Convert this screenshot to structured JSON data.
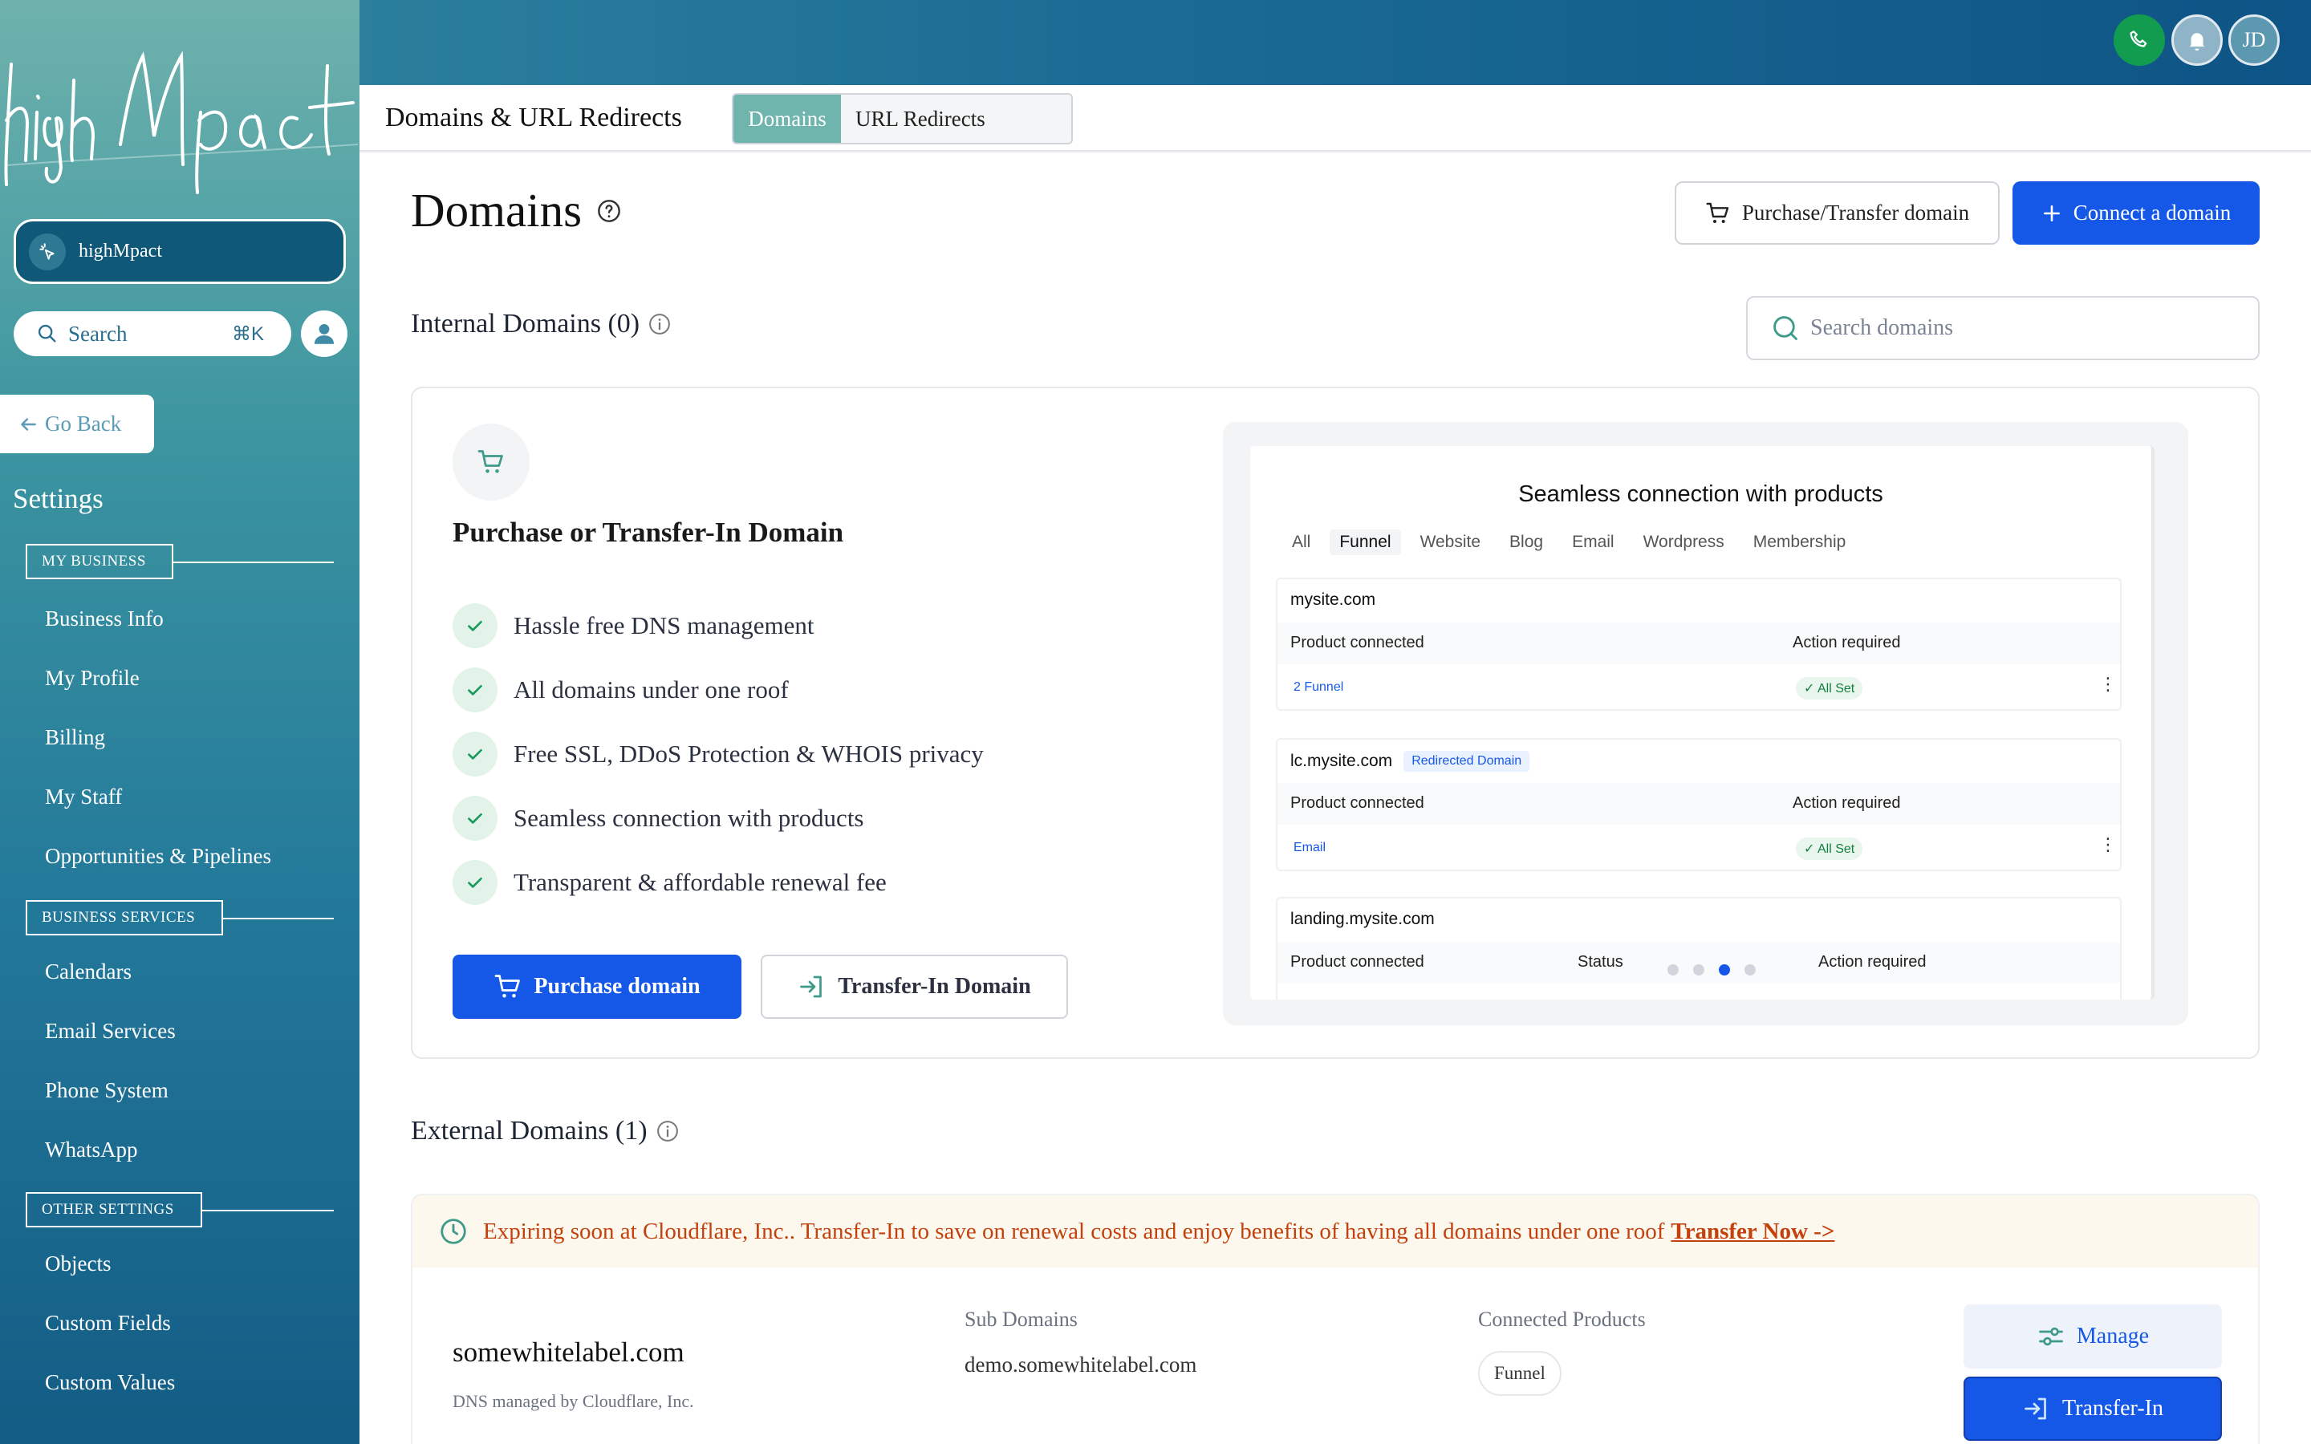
{
  "brand": {
    "logo_text": "highMpact"
  },
  "sidebar": {
    "location_name": "highMpact",
    "search_label": "Search",
    "search_shortcut": "⌘K",
    "go_back_label": "Go Back",
    "settings_title": "Settings",
    "sections": [
      {
        "title": "MY BUSINESS",
        "items": [
          "Business Info",
          "My Profile",
          "Billing",
          "My Staff",
          "Opportunities & Pipelines"
        ]
      },
      {
        "title": "BUSINESS SERVICES",
        "items": [
          "Calendars",
          "Email Services",
          "Phone System",
          "WhatsApp"
        ]
      },
      {
        "title": "OTHER SETTINGS",
        "items": [
          "Objects",
          "Custom Fields",
          "Custom Values"
        ]
      }
    ]
  },
  "topbar": {
    "avatar_initials": "JD",
    "icons": [
      "phone-icon",
      "bell-icon"
    ]
  },
  "subheader": {
    "title": "Domains & URL Redirects",
    "tabs": [
      {
        "label": "Domains",
        "active": true
      },
      {
        "label": "URL Redirects",
        "active": false
      }
    ]
  },
  "main": {
    "heading": "Domains",
    "purchase_transfer_label": "Purchase/Transfer domain",
    "connect_label": "Connect a domain",
    "internal_heading": "Internal Domains (0)",
    "search_placeholder": "Search domains",
    "promo": {
      "title": "Purchase or Transfer-In Domain",
      "features": [
        "Hassle free DNS management",
        "All domains under one roof",
        "Free SSL, DDoS Protection & WHOIS privacy",
        "Seamless connection with products",
        "Transparent & affordable renewal fee"
      ],
      "purchase_label": "Purchase domain",
      "transfer_label": "Transfer-In Domain"
    },
    "preview": {
      "title": "Seamless connection with products",
      "tabs": [
        "All",
        "Funnel",
        "Website",
        "Blog",
        "Email",
        "Wordpress",
        "Membership"
      ],
      "active_tab": "Funnel",
      "blocks": [
        {
          "domain": "mysite.com",
          "badge": "",
          "col1": "Product connected",
          "col2": "Action required",
          "product": "2 Funnel",
          "status": "All Set"
        },
        {
          "domain": "lc.mysite.com",
          "badge": "Redirected Domain",
          "col1": "Product connected",
          "col2": "Action required",
          "product": "Email",
          "status": "All Set"
        },
        {
          "domain": "landing.mysite.com",
          "badge": "",
          "col1": "Product connected",
          "col_status": "Status",
          "col2": "Action required"
        }
      ],
      "carousel": {
        "count": 4,
        "active_index": 2
      }
    },
    "external_heading": "External Domains (1)",
    "external": {
      "banner_text": "Expiring soon at Cloudflare, Inc.. Transfer-In to save on renewal costs and enjoy benefits of having all domains under one roof",
      "banner_link": "Transfer Now ->",
      "domain": "somewhitelabel.com",
      "dns_text": "DNS managed by Cloudflare, Inc.",
      "sub_label": "Sub Domains",
      "sub_value": "demo.somewhitelabel.com",
      "cp_label": "Connected Products",
      "cp_value": "Funnel",
      "manage_label": "Manage",
      "transfer_in_label": "Transfer-In"
    }
  },
  "colors": {
    "primary": "#1558e8",
    "teal_tab": "#6fb5ad",
    "success": "#119c4f",
    "warning_text": "#c2410c"
  }
}
